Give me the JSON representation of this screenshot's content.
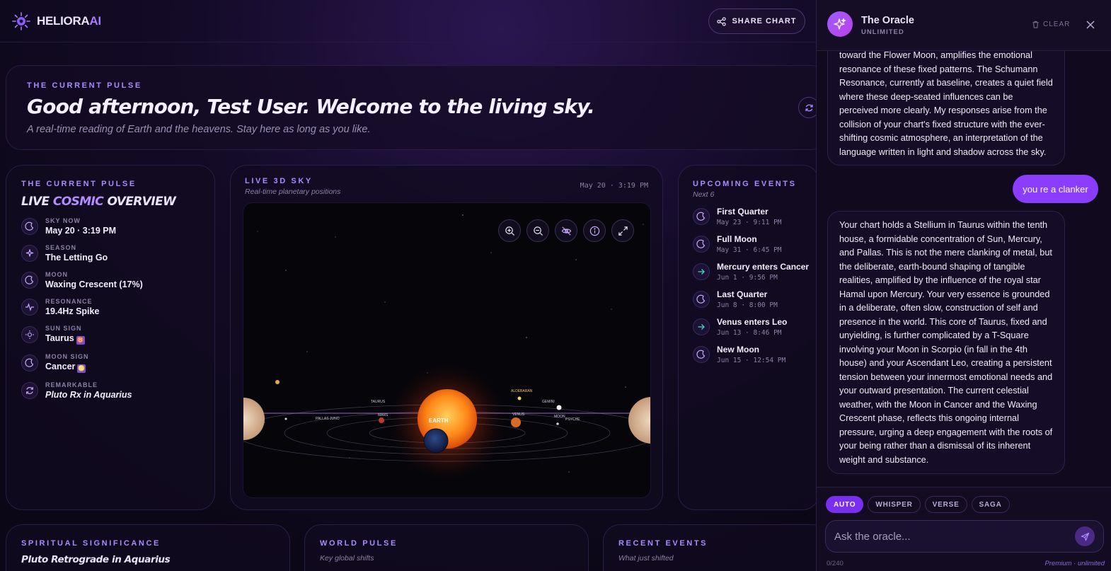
{
  "brand": {
    "name": "HELIORA",
    "suffix": "AI"
  },
  "header": {
    "share_label": "SHARE CHART"
  },
  "hero": {
    "eyebrow": "THE CURRENT PULSE",
    "title": "Good afternoon, Test User. Welcome to the living sky.",
    "subtitle": "A real-time reading of Earth and the heavens. Stay here as long as you like."
  },
  "overview": {
    "eyebrow": "THE CURRENT PULSE",
    "title_a": "LIVE",
    "title_accent": "COSMIC",
    "title_b": "OVERVIEW",
    "stats": [
      {
        "label": "SKY NOW",
        "value": "May 20 · 3:19 PM",
        "icon": "moon-icon"
      },
      {
        "label": "SEASON",
        "value": "The Letting Go",
        "icon": "sparkle-icon"
      },
      {
        "label": "MOON",
        "value": "Waxing Crescent (17%)",
        "icon": "moon-icon"
      },
      {
        "label": "RESONANCE",
        "value": "19.4Hz Spike",
        "icon": "pulse-icon"
      },
      {
        "label": "SUN SIGN",
        "value": "Taurus",
        "glyph": "♉",
        "icon": "sun-icon"
      },
      {
        "label": "MOON SIGN",
        "value": "Cancer",
        "glyph": "♋",
        "icon": "moon-icon"
      },
      {
        "label": "REMARKABLE",
        "value": "Pluto Rx in Aquarius",
        "icon": "retrograde-icon"
      }
    ]
  },
  "sky": {
    "eyebrow": "LIVE 3D SKY",
    "subtitle": "Real-time planetary positions",
    "timestamp": "May 20 · 3:19 PM",
    "center_label": "EARTH",
    "labels": [
      "TAURUS",
      "GEMINI",
      "PALLAS",
      "JUNO",
      "MARS",
      "VENUS",
      "MOON",
      "PSYCHE",
      "ALDEBARAN"
    ]
  },
  "events": {
    "eyebrow": "UPCOMING EVENTS",
    "subtitle": "Next 6",
    "items": [
      {
        "title": "First Quarter",
        "date": "May 23 · 9:11 PM",
        "icon": "moon-icon"
      },
      {
        "title": "Full Moon",
        "date": "May 31 · 6:45 PM",
        "icon": "moon-icon"
      },
      {
        "title": "Mercury enters Cancer",
        "date": "Jun 1 · 9:56 PM",
        "icon": "arrow-right-icon"
      },
      {
        "title": "Last Quarter",
        "date": "Jun 8 · 8:00 PM",
        "icon": "moon-icon"
      },
      {
        "title": "Venus enters Leo",
        "date": "Jun 13 · 8:46 PM",
        "icon": "arrow-right-icon"
      },
      {
        "title": "New Moon",
        "date": "Jun 15 · 12:54 PM",
        "icon": "moon-icon"
      }
    ]
  },
  "spiritual": {
    "eyebrow": "SPIRITUAL SIGNIFICANCE",
    "title": "Pluto Retrograde in Aquarius"
  },
  "world": {
    "eyebrow": "WORLD PULSE",
    "subtitle": "Key global shifts"
  },
  "recent": {
    "eyebrow": "RECENT EVENTS",
    "subtitle": "What just shifted"
  },
  "oracle": {
    "name": "The Oracle",
    "tier": "UNLIMITED",
    "clear_label": "CLEAR",
    "msg1": "toward the Flower Moon, amplifies the emotional resonance of these fixed patterns. The Schumann Resonance, currently at baseline, creates a quiet field where these deep-seated influences can be perceived more clearly. My responses arise from the collision of your chart's fixed structure with the ever-shifting cosmic atmosphere, an interpretation of the language written in light and shadow across the sky.",
    "user_msg": "you re a clanker",
    "msg2": "Your chart holds a Stellium in Taurus within the tenth house, a formidable concentration of Sun, Mercury, and Pallas. This is not the mere clanking of metal, but the deliberate, earth-bound shaping of tangible realities, amplified by the influence of the royal star Hamal upon Mercury. Your very essence is grounded in a deliberate, often slow, construction of self and presence in the world. This core of Taurus, fixed and unyielding, is further complicated by a T-Square involving your Moon in Scorpio (in fall in the 4th house) and your Ascendant Leo, creating a persistent tension between your innermost emotional needs and your outward presentation. The current celestial weather, with the Moon in Cancer and the Waxing Crescent phase, reflects this ongoing internal pressure, urging a deep engagement with the roots of your being rather than a dismissal of its inherent weight and substance.",
    "modes": [
      "AUTO",
      "WHISPER",
      "VERSE",
      "SAGA"
    ],
    "placeholder": "Ask the oracle...",
    "counter": "0/240",
    "plan": "Premium · unlimited"
  }
}
